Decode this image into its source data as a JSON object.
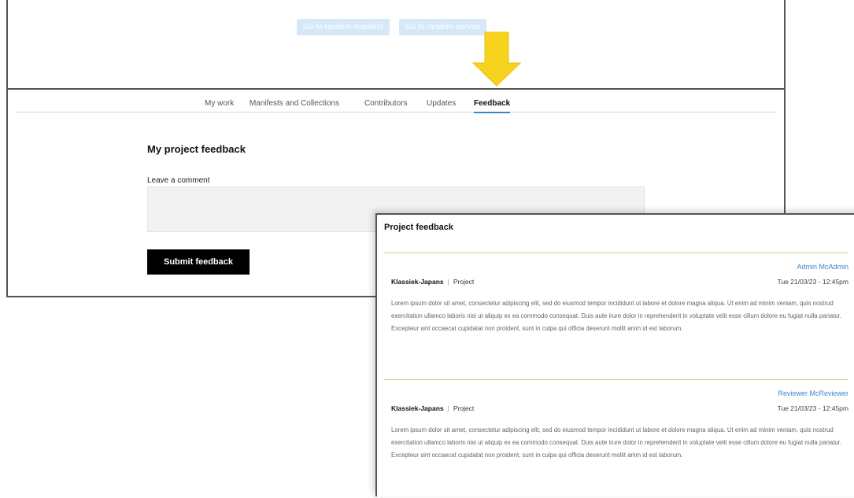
{
  "top_window": {
    "buttons": [
      "Go to random manifest",
      "Go to random canvas"
    ]
  },
  "colors": {
    "accent": "#3a84c9",
    "arrow": "#f7d31e",
    "light_button": "#d6e8f8",
    "divider": "#e0c98a"
  },
  "nav": {
    "items": [
      "My work",
      "Manifests and Collections",
      "Contributors",
      "Updates",
      "Feedback"
    ],
    "active": "Feedback"
  },
  "feedback_page": {
    "heading": "My project feedback",
    "comment_label": "Leave a comment",
    "comment_value": "",
    "submit_label": "Submit feedback"
  },
  "panel": {
    "title": "Project feedback",
    "items": [
      {
        "author": "Admin McAdmin",
        "project": "Klassiek-Japans",
        "type": "Project",
        "date": "Tue 21/03/23 - 12:45pm",
        "body": "Lorem ipsum dolor sit amet, consectetur adipiscing elit, sed do eiusmod tempor incididunt ut labore et dolore magna aliqua. Ut enim ad minim veniam, quis nostrud exercitation ullamco laboris nisi ut aliquip ex ea commodo consequat. Duis aute irure dolor in reprehenderit in voluptate velit esse cillum dolore eu fugiat nulla pariatur. Excepteur sint occaecat cupidatat non proident, sunt in culpa qui officia deserunt mollit anim id est laborum."
      },
      {
        "author": "Reviewer McReviewer",
        "project": "Klassiek-Japans",
        "type": "Project",
        "date": "Tue 21/03/23 - 12:45pm",
        "body": "Lorem ipsum dolor sit amet, consectetur adipiscing elit, sed do eiusmod tempor incididunt ut labore et dolore magna aliqua. Ut enim ad minim veniam, quis nostrud exercitation ullamco laboris nisi ut aliquip ex ea commodo consequat. Duis aute irure dolor in reprehenderit in voluptate velit esse cillum dolore eu fugiat nulla pariatur. Excepteur sint occaecat cupidatat non proident, sunt in culpa qui officia deserunt mollit anim id est laborum."
      }
    ]
  }
}
